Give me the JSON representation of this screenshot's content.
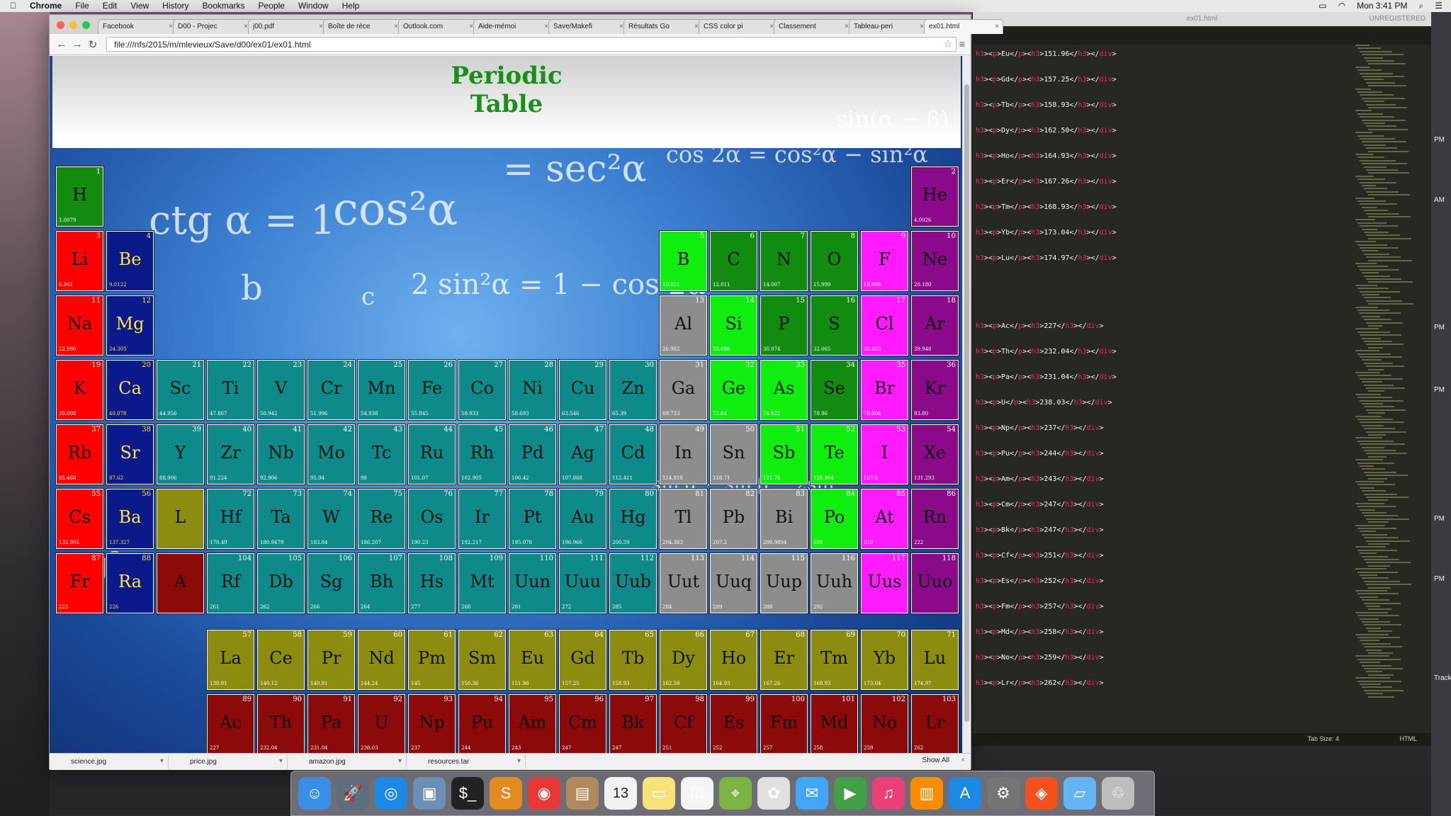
{
  "menubar": {
    "apple": "",
    "items": [
      "Chrome",
      "File",
      "Edit",
      "View",
      "History",
      "Bookmarks",
      "People",
      "Window",
      "Help"
    ],
    "clock": "Mon 3:41 PM"
  },
  "browser": {
    "tabs": [
      "Facebook",
      "D00 - Projec",
      "j00.pdf",
      "Boîte de réce",
      "Outlook.com",
      "Aide-mémoi",
      "Save/Makefi",
      "Résultats Go",
      "CSS color pi",
      "Classement",
      "Tableau-peri",
      "ex01.html"
    ],
    "active_tab": "ex01.html",
    "url": "file:///nfs/2015/m/mlevieux/Save/d00/ex01/ex01.html",
    "downloads": [
      "science.jpg",
      "price.jpg",
      "amazon.jpg",
      "resources.tar"
    ],
    "show_all": "Show All"
  },
  "page": {
    "title_line1": "Periodic",
    "title_line2": "Table",
    "math_texts": [
      "cos²α",
      "= sec²α",
      "cos 2α = cos²α − sin²α",
      "sin(α − β)",
      "ctg α = 1",
      "2 sin²α = 1 − cos 2α",
      "b",
      "c",
      "ctg²α +",
      "sin α − sin β − 2sin"
    ]
  },
  "elements": [
    {
      "sym": "H",
      "num": "1",
      "mass": "1.0079",
      "cat": "nonmetal",
      "r": 1,
      "c": 1
    },
    {
      "sym": "He",
      "num": "2",
      "mass": "4.0026",
      "cat": "noble",
      "r": 1,
      "c": 18
    },
    {
      "sym": "Li",
      "num": "3",
      "mass": "6.941",
      "cat": "alkali",
      "r": 2,
      "c": 1
    },
    {
      "sym": "Be",
      "num": "4",
      "mass": "9.0122",
      "cat": "alkaline",
      "r": 2,
      "c": 2
    },
    {
      "sym": "B",
      "num": "5",
      "mass": "10.811",
      "cat": "metalloid",
      "r": 2,
      "c": 13
    },
    {
      "sym": "C",
      "num": "6",
      "mass": "12.011",
      "cat": "nonmetal",
      "r": 2,
      "c": 14
    },
    {
      "sym": "N",
      "num": "7",
      "mass": "14.007",
      "cat": "nonmetal",
      "r": 2,
      "c": 15
    },
    {
      "sym": "O",
      "num": "8",
      "mass": "15.999",
      "cat": "nonmetal",
      "r": 2,
      "c": 16
    },
    {
      "sym": "F",
      "num": "9",
      "mass": "18.998",
      "cat": "halogen",
      "r": 2,
      "c": 17
    },
    {
      "sym": "Ne",
      "num": "10",
      "mass": "20.180",
      "cat": "noble",
      "r": 2,
      "c": 18
    },
    {
      "sym": "Na",
      "num": "11",
      "mass": "22.990",
      "cat": "alkali",
      "r": 3,
      "c": 1
    },
    {
      "sym": "Mg",
      "num": "12",
      "mass": "24.305",
      "cat": "alkaline",
      "r": 3,
      "c": 2
    },
    {
      "sym": "Al",
      "num": "13",
      "mass": "26.982",
      "cat": "post",
      "r": 3,
      "c": 13
    },
    {
      "sym": "Si",
      "num": "14",
      "mass": "28.086",
      "cat": "metalloid",
      "r": 3,
      "c": 14
    },
    {
      "sym": "P",
      "num": "15",
      "mass": "30.974",
      "cat": "nonmetal",
      "r": 3,
      "c": 15
    },
    {
      "sym": "S",
      "num": "16",
      "mass": "32.065",
      "cat": "nonmetal",
      "r": 3,
      "c": 16
    },
    {
      "sym": "Cl",
      "num": "17",
      "mass": "35.453",
      "cat": "halogen",
      "r": 3,
      "c": 17
    },
    {
      "sym": "Ar",
      "num": "18",
      "mass": "39.948",
      "cat": "noble",
      "r": 3,
      "c": 18
    },
    {
      "sym": "K",
      "num": "19",
      "mass": "39.098",
      "cat": "alkali",
      "r": 4,
      "c": 1
    },
    {
      "sym": "Ca",
      "num": "20",
      "mass": "40.078",
      "cat": "alkaline",
      "r": 4,
      "c": 2
    },
    {
      "sym": "Sc",
      "num": "21",
      "mass": "44.956",
      "cat": "trans",
      "r": 4,
      "c": 3
    },
    {
      "sym": "Ti",
      "num": "22",
      "mass": "47.867",
      "cat": "trans",
      "r": 4,
      "c": 4
    },
    {
      "sym": "V",
      "num": "23",
      "mass": "50.942",
      "cat": "trans",
      "r": 4,
      "c": 5
    },
    {
      "sym": "Cr",
      "num": "24",
      "mass": "51.996",
      "cat": "trans",
      "r": 4,
      "c": 6
    },
    {
      "sym": "Mn",
      "num": "25",
      "mass": "54.938",
      "cat": "trans",
      "r": 4,
      "c": 7
    },
    {
      "sym": "Fe",
      "num": "26",
      "mass": "55.845",
      "cat": "trans",
      "r": 4,
      "c": 8
    },
    {
      "sym": "Co",
      "num": "27",
      "mass": "58.933",
      "cat": "trans",
      "r": 4,
      "c": 9
    },
    {
      "sym": "Ni",
      "num": "28",
      "mass": "58.693",
      "cat": "trans",
      "r": 4,
      "c": 10
    },
    {
      "sym": "Cu",
      "num": "29",
      "mass": "63.546",
      "cat": "trans",
      "r": 4,
      "c": 11
    },
    {
      "sym": "Zn",
      "num": "30",
      "mass": "65.39",
      "cat": "trans",
      "r": 4,
      "c": 12
    },
    {
      "sym": "Ga",
      "num": "31",
      "mass": "69.723",
      "cat": "post",
      "r": 4,
      "c": 13
    },
    {
      "sym": "Ge",
      "num": "32",
      "mass": "72.64",
      "cat": "metalloid",
      "r": 4,
      "c": 14
    },
    {
      "sym": "As",
      "num": "33",
      "mass": "74.922",
      "cat": "metalloid",
      "r": 4,
      "c": 15
    },
    {
      "sym": "Se",
      "num": "34",
      "mass": "78.96",
      "cat": "nonmetal",
      "r": 4,
      "c": 16
    },
    {
      "sym": "Br",
      "num": "35",
      "mass": "79.904",
      "cat": "halogen",
      "r": 4,
      "c": 17
    },
    {
      "sym": "Kr",
      "num": "36",
      "mass": "83.80",
      "cat": "noble",
      "r": 4,
      "c": 18
    },
    {
      "sym": "Rb",
      "num": "37",
      "mass": "85.468",
      "cat": "alkali",
      "r": 5,
      "c": 1
    },
    {
      "sym": "Sr",
      "num": "38",
      "mass": "87.62",
      "cat": "alkaline",
      "r": 5,
      "c": 2
    },
    {
      "sym": "Y",
      "num": "39",
      "mass": "88.906",
      "cat": "trans",
      "r": 5,
      "c": 3
    },
    {
      "sym": "Zr",
      "num": "40",
      "mass": "91.224",
      "cat": "trans",
      "r": 5,
      "c": 4
    },
    {
      "sym": "Nb",
      "num": "41",
      "mass": "92.906",
      "cat": "trans",
      "r": 5,
      "c": 5
    },
    {
      "sym": "Mo",
      "num": "42",
      "mass": "95.94",
      "cat": "trans",
      "r": 5,
      "c": 6
    },
    {
      "sym": "Tc",
      "num": "43",
      "mass": "98",
      "cat": "trans",
      "r": 5,
      "c": 7
    },
    {
      "sym": "Ru",
      "num": "44",
      "mass": "101.07",
      "cat": "trans",
      "r": 5,
      "c": 8
    },
    {
      "sym": "Rh",
      "num": "45",
      "mass": "102.905",
      "cat": "trans",
      "r": 5,
      "c": 9
    },
    {
      "sym": "Pd",
      "num": "46",
      "mass": "106.42",
      "cat": "trans",
      "r": 5,
      "c": 10
    },
    {
      "sym": "Ag",
      "num": "47",
      "mass": "107.868",
      "cat": "trans",
      "r": 5,
      "c": 11
    },
    {
      "sym": "Cd",
      "num": "48",
      "mass": "112.411",
      "cat": "trans",
      "r": 5,
      "c": 12
    },
    {
      "sym": "In",
      "num": "49",
      "mass": "114.818",
      "cat": "post",
      "r": 5,
      "c": 13
    },
    {
      "sym": "Sn",
      "num": "50",
      "mass": "118.71",
      "cat": "post",
      "r": 5,
      "c": 14
    },
    {
      "sym": "Sb",
      "num": "51",
      "mass": "121.76",
      "cat": "metalloid",
      "r": 5,
      "c": 15
    },
    {
      "sym": "Te",
      "num": "52",
      "mass": "126.904",
      "cat": "metalloid",
      "r": 5,
      "c": 16
    },
    {
      "sym": "I",
      "num": "53",
      "mass": "127.6",
      "cat": "halogen",
      "r": 5,
      "c": 17
    },
    {
      "sym": "Xe",
      "num": "54",
      "mass": "131.293",
      "cat": "noble",
      "r": 5,
      "c": 18
    },
    {
      "sym": "Cs",
      "num": "55",
      "mass": "132.905",
      "cat": "alkali",
      "r": 6,
      "c": 1
    },
    {
      "sym": "Ba",
      "num": "56",
      "mass": "137.327",
      "cat": "alkaline",
      "r": 6,
      "c": 2
    },
    {
      "sym": "L",
      "num": "",
      "mass": "",
      "cat": "lan",
      "r": 6,
      "c": 3
    },
    {
      "sym": "Hf",
      "num": "72",
      "mass": "178.49",
      "cat": "trans",
      "r": 6,
      "c": 4
    },
    {
      "sym": "Ta",
      "num": "73",
      "mass": "180.9479",
      "cat": "trans",
      "r": 6,
      "c": 5
    },
    {
      "sym": "W",
      "num": "74",
      "mass": "183.84",
      "cat": "trans",
      "r": 6,
      "c": 6
    },
    {
      "sym": "Re",
      "num": "75",
      "mass": "186.207",
      "cat": "trans",
      "r": 6,
      "c": 7
    },
    {
      "sym": "Os",
      "num": "76",
      "mass": "190.23",
      "cat": "trans",
      "r": 6,
      "c": 8
    },
    {
      "sym": "Ir",
      "num": "77",
      "mass": "192.217",
      "cat": "trans",
      "r": 6,
      "c": 9
    },
    {
      "sym": "Pt",
      "num": "78",
      "mass": "195.078",
      "cat": "trans",
      "r": 6,
      "c": 10
    },
    {
      "sym": "Au",
      "num": "79",
      "mass": "196.966",
      "cat": "trans",
      "r": 6,
      "c": 11
    },
    {
      "sym": "Hg",
      "num": "80",
      "mass": "200.59",
      "cat": "trans",
      "r": 6,
      "c": 12
    },
    {
      "sym": "Tl",
      "num": "81",
      "mass": "204.383",
      "cat": "post",
      "r": 6,
      "c": 13
    },
    {
      "sym": "Pb",
      "num": "82",
      "mass": "207.2",
      "cat": "post",
      "r": 6,
      "c": 14
    },
    {
      "sym": "Bi",
      "num": "83",
      "mass": "208.9804",
      "cat": "post",
      "r": 6,
      "c": 15
    },
    {
      "sym": "Po",
      "num": "84",
      "mass": "209",
      "cat": "metalloid",
      "r": 6,
      "c": 16
    },
    {
      "sym": "At",
      "num": "85",
      "mass": "210",
      "cat": "halogen",
      "r": 6,
      "c": 17
    },
    {
      "sym": "Rn",
      "num": "86",
      "mass": "222",
      "cat": "noble",
      "r": 6,
      "c": 18
    },
    {
      "sym": "Fr",
      "num": "87",
      "mass": "223",
      "cat": "alkali",
      "r": 7,
      "c": 1
    },
    {
      "sym": "Ra",
      "num": "88",
      "mass": "226",
      "cat": "alkaline",
      "r": 7,
      "c": 2
    },
    {
      "sym": "A",
      "num": "",
      "mass": "",
      "cat": "act",
      "r": 7,
      "c": 3
    },
    {
      "sym": "Rf",
      "num": "104",
      "mass": "261",
      "cat": "trans",
      "r": 7,
      "c": 4
    },
    {
      "sym": "Db",
      "num": "105",
      "mass": "262",
      "cat": "trans",
      "r": 7,
      "c": 5
    },
    {
      "sym": "Sg",
      "num": "106",
      "mass": "266",
      "cat": "trans",
      "r": 7,
      "c": 6
    },
    {
      "sym": "Bh",
      "num": "107",
      "mass": "264",
      "cat": "trans",
      "r": 7,
      "c": 7
    },
    {
      "sym": "Hs",
      "num": "108",
      "mass": "277",
      "cat": "trans",
      "r": 7,
      "c": 8
    },
    {
      "sym": "Mt",
      "num": "109",
      "mass": "268",
      "cat": "trans",
      "r": 7,
      "c": 9
    },
    {
      "sym": "Uun",
      "num": "110",
      "mass": "281",
      "cat": "trans",
      "r": 7,
      "c": 10
    },
    {
      "sym": "Uuu",
      "num": "111",
      "mass": "272",
      "cat": "trans",
      "r": 7,
      "c": 11
    },
    {
      "sym": "Uub",
      "num": "112",
      "mass": "285",
      "cat": "trans",
      "r": 7,
      "c": 12
    },
    {
      "sym": "Uut",
      "num": "113",
      "mass": "284",
      "cat": "post",
      "r": 7,
      "c": 13
    },
    {
      "sym": "Uuq",
      "num": "114",
      "mass": "289",
      "cat": "post",
      "r": 7,
      "c": 14
    },
    {
      "sym": "Uup",
      "num": "115",
      "mass": "288",
      "cat": "post",
      "r": 7,
      "c": 15
    },
    {
      "sym": "Uuh",
      "num": "116",
      "mass": "292",
      "cat": "post",
      "r": 7,
      "c": 16
    },
    {
      "sym": "Uus",
      "num": "117",
      "mass": "",
      "cat": "halogen",
      "r": 7,
      "c": 17
    },
    {
      "sym": "Uuo",
      "num": "118",
      "mass": "",
      "cat": "noble",
      "r": 7,
      "c": 18
    },
    {
      "sym": "La",
      "num": "57",
      "mass": "138.91",
      "cat": "lan",
      "r": 9,
      "c": 4
    },
    {
      "sym": "Ce",
      "num": "58",
      "mass": "140.12",
      "cat": "lan",
      "r": 9,
      "c": 5
    },
    {
      "sym": "Pr",
      "num": "59",
      "mass": "140.91",
      "cat": "lan",
      "r": 9,
      "c": 6
    },
    {
      "sym": "Nd",
      "num": "60",
      "mass": "144.24",
      "cat": "lan",
      "r": 9,
      "c": 7
    },
    {
      "sym": "Pm",
      "num": "61",
      "mass": "145",
      "cat": "lan",
      "r": 9,
      "c": 8
    },
    {
      "sym": "Sm",
      "num": "62",
      "mass": "150.36",
      "cat": "lan",
      "r": 9,
      "c": 9
    },
    {
      "sym": "Eu",
      "num": "63",
      "mass": "151.96",
      "cat": "lan",
      "r": 9,
      "c": 10
    },
    {
      "sym": "Gd",
      "num": "64",
      "mass": "157.25",
      "cat": "lan",
      "r": 9,
      "c": 11
    },
    {
      "sym": "Tb",
      "num": "65",
      "mass": "158.93",
      "cat": "lan",
      "r": 9,
      "c": 12
    },
    {
      "sym": "Dy",
      "num": "66",
      "mass": "162.50",
      "cat": "lan",
      "r": 9,
      "c": 13
    },
    {
      "sym": "Ho",
      "num": "67",
      "mass": "164.93",
      "cat": "lan",
      "r": 9,
      "c": 14
    },
    {
      "sym": "Er",
      "num": "68",
      "mass": "167.26",
      "cat": "lan",
      "r": 9,
      "c": 15
    },
    {
      "sym": "Tm",
      "num": "69",
      "mass": "168.93",
      "cat": "lan",
      "r": 9,
      "c": 16
    },
    {
      "sym": "Yb",
      "num": "70",
      "mass": "173.04",
      "cat": "lan",
      "r": 9,
      "c": 17
    },
    {
      "sym": "Lu",
      "num": "71",
      "mass": "174.97",
      "cat": "lan",
      "r": 9,
      "c": 18
    },
    {
      "sym": "Ac",
      "num": "89",
      "mass": "227",
      "cat": "act",
      "r": 10,
      "c": 4
    },
    {
      "sym": "Th",
      "num": "90",
      "mass": "232.04",
      "cat": "act",
      "r": 10,
      "c": 5
    },
    {
      "sym": "Pa",
      "num": "91",
      "mass": "231.04",
      "cat": "act",
      "r": 10,
      "c": 6
    },
    {
      "sym": "U",
      "num": "92",
      "mass": "238.03",
      "cat": "act",
      "r": 10,
      "c": 7
    },
    {
      "sym": "Np",
      "num": "93",
      "mass": "237",
      "cat": "act",
      "r": 10,
      "c": 8
    },
    {
      "sym": "Pu",
      "num": "94",
      "mass": "244",
      "cat": "act",
      "r": 10,
      "c": 9
    },
    {
      "sym": "Am",
      "num": "95",
      "mass": "243",
      "cat": "act",
      "r": 10,
      "c": 10
    },
    {
      "sym": "Cm",
      "num": "96",
      "mass": "247",
      "cat": "act",
      "r": 10,
      "c": 11
    },
    {
      "sym": "Bk",
      "num": "97",
      "mass": "247",
      "cat": "act",
      "r": 10,
      "c": 12
    },
    {
      "sym": "Cf",
      "num": "98",
      "mass": "251",
      "cat": "act",
      "r": 10,
      "c": 13
    },
    {
      "sym": "Es",
      "num": "99",
      "mass": "252",
      "cat": "act",
      "r": 10,
      "c": 14
    },
    {
      "sym": "Fm",
      "num": "100",
      "mass": "257",
      "cat": "act",
      "r": 10,
      "c": 15
    },
    {
      "sym": "Md",
      "num": "101",
      "mass": "258",
      "cat": "act",
      "r": 10,
      "c": 16
    },
    {
      "sym": "No",
      "num": "102",
      "mass": "259",
      "cat": "act",
      "r": 10,
      "c": 17
    },
    {
      "sym": "Lr",
      "num": "103",
      "mass": "262",
      "cat": "act",
      "r": 10,
      "c": 18
    }
  ],
  "editor": {
    "title": "ex01.html",
    "unregistered": "UNREGISTERED",
    "status_tab": "Tab Size: 4",
    "status_lang": "HTML",
    "lines_top": [
      [
        "Eu",
        "151.96"
      ],
      [
        "Gd",
        "157.25"
      ],
      [
        "Tb",
        "158.93"
      ],
      [
        "Dy",
        "162.50"
      ],
      [
        "Ho",
        "164.93"
      ],
      [
        "Er",
        "167.26"
      ],
      [
        "Tm",
        "168.93"
      ],
      [
        "Yb",
        "173.04"
      ],
      [
        "Lu",
        "174.97"
      ]
    ],
    "lines_bottom": [
      [
        "Ac",
        "227"
      ],
      [
        "Th",
        "232.04"
      ],
      [
        "Pa",
        "231.04"
      ],
      [
        "U",
        "238.03"
      ],
      [
        "Np",
        "237"
      ],
      [
        "Pu",
        "244"
      ],
      [
        "Am",
        "243"
      ],
      [
        "Cm",
        "247"
      ],
      [
        "Bk",
        "247"
      ],
      [
        "Cf",
        "251"
      ],
      [
        "Es",
        "252"
      ],
      [
        "Fm",
        "257"
      ],
      [
        "Md",
        "258"
      ],
      [
        "No",
        "259"
      ],
      [
        "Lr",
        "262"
      ]
    ]
  },
  "rightstrip": [
    "PM",
    "AM",
    "PM",
    "PM",
    "PM",
    "PM"
  ],
  "rightstrip_label": "Track",
  "dock": [
    "Finder",
    "Launchpad",
    "Safari",
    "Preview",
    "Terminal",
    "Sublime",
    "Chrome",
    "Contacts",
    "Calendar",
    "Notes",
    "Reminders",
    "Maps",
    "Photos",
    "Messages",
    "FaceTime",
    "iTunes",
    "iBooks",
    "App Store",
    "System Preferences",
    "Firefox",
    "Folder",
    "Trash"
  ],
  "calendar_day": "13",
  "colors": {
    "alkali": "#ff0000",
    "alkaline": "#0a1a8a",
    "trans": "#0e8a8a",
    "post": "#8d8d8d",
    "metalloid": "#10ee10",
    "nonmetal": "#118c11",
    "halogen": "#ff1aff",
    "noble": "#8a0a8a",
    "lan": "#8c8c10",
    "act": "#8c0a0a",
    "title": "#189018"
  }
}
